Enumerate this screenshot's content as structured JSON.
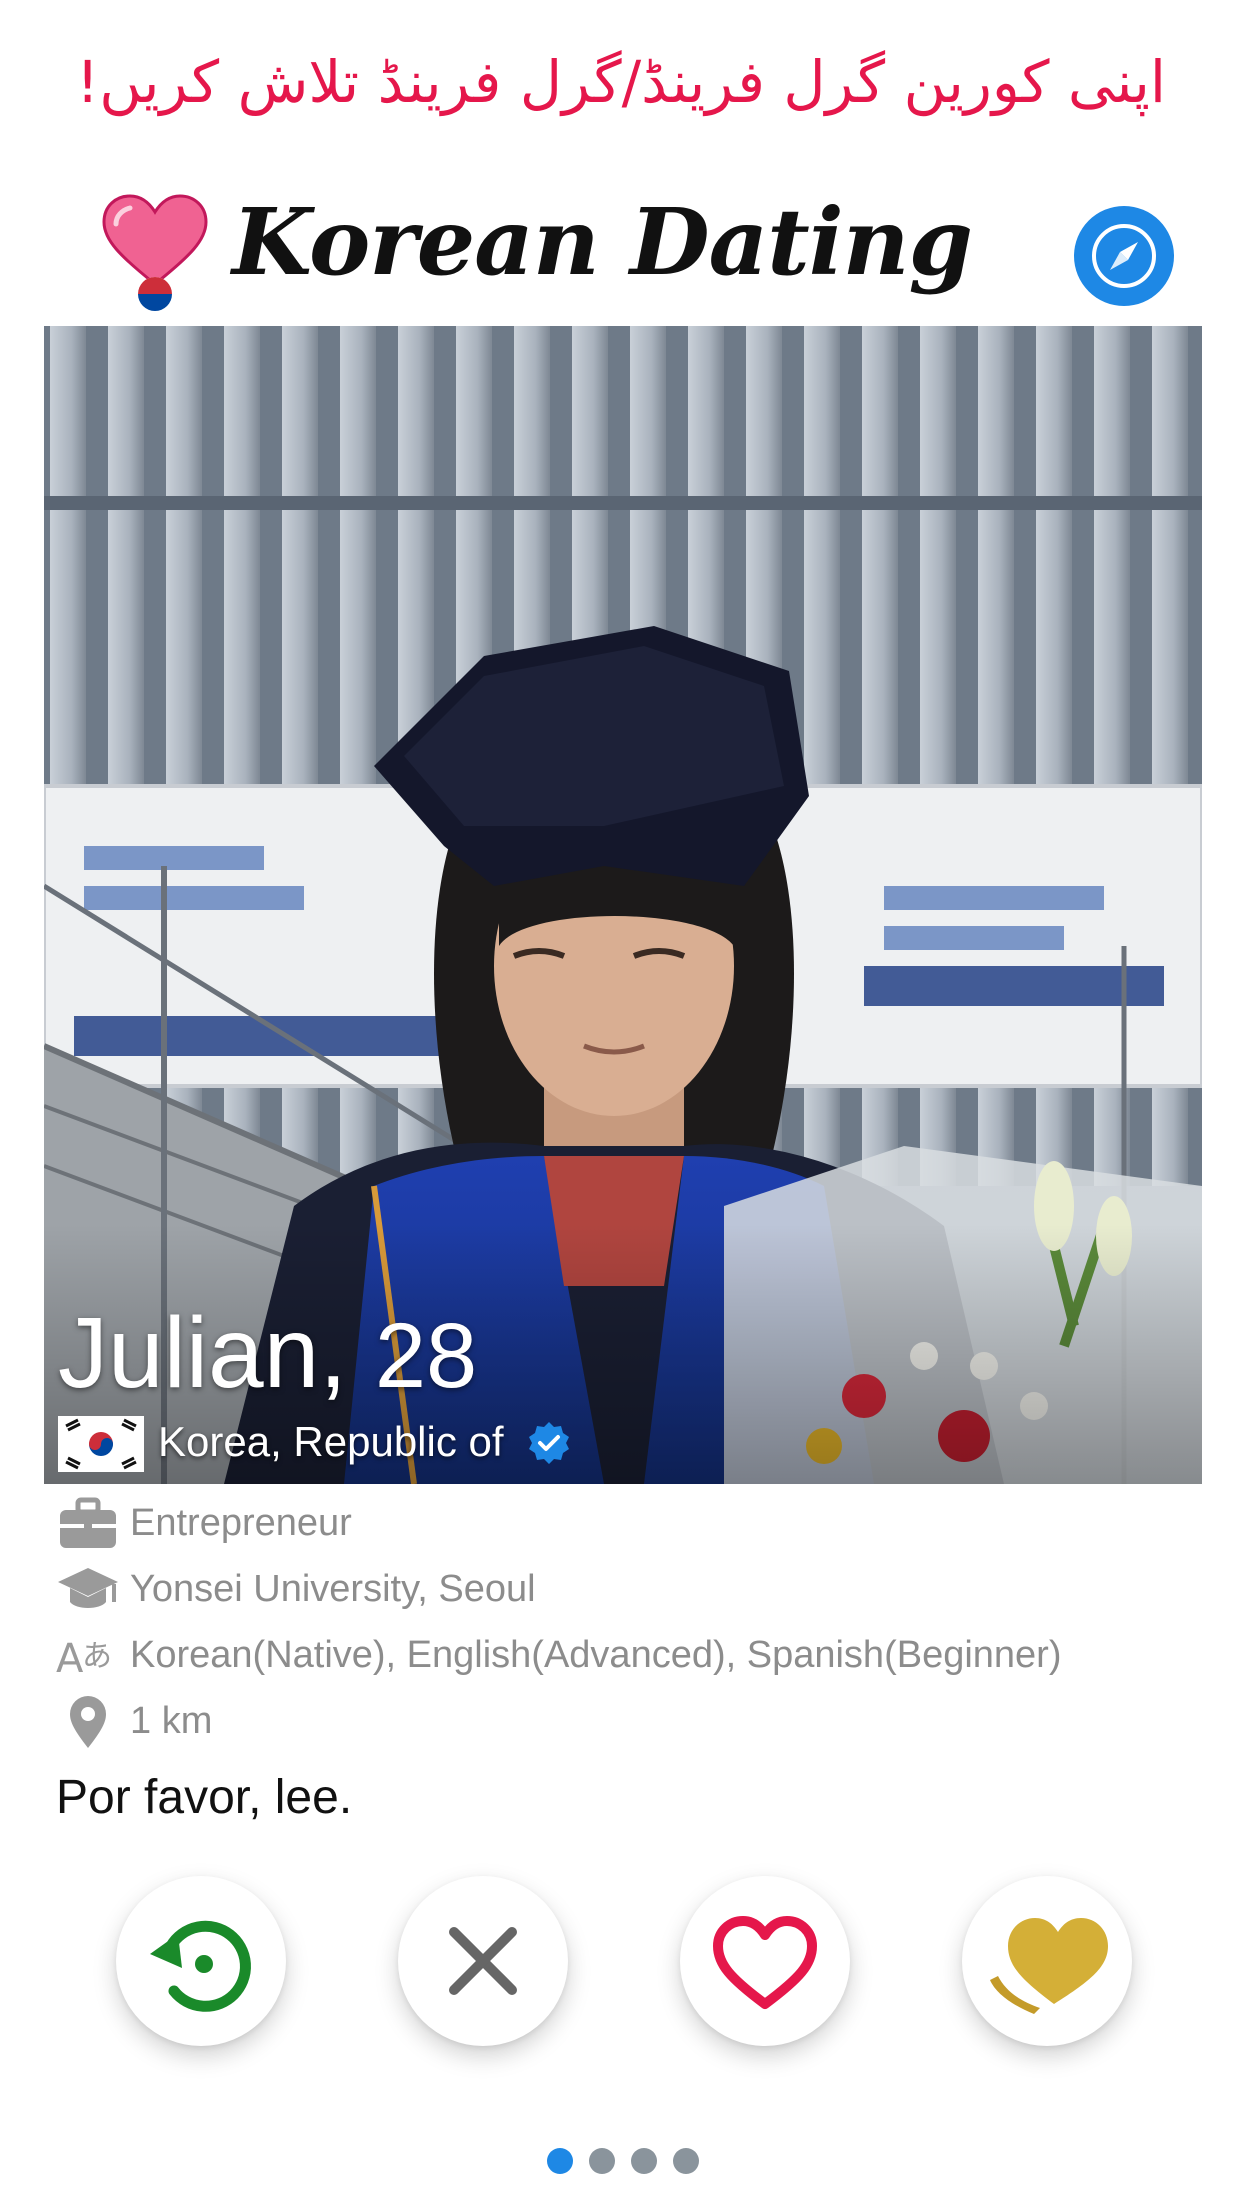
{
  "banner": {
    "text": "اپنی کورین گرل فرینڈ/گرل فرینڈ تلاش کریں!"
  },
  "header": {
    "app_name": "Korean Dating",
    "logo_icon": "heart-pin-icon",
    "discover_icon": "compass-icon"
  },
  "profile": {
    "name": "Julian,",
    "age": "28",
    "country": "Korea, Republic of",
    "verified": true,
    "details": [
      {
        "icon": "briefcase-icon",
        "text": "Entrepreneur"
      },
      {
        "icon": "graduation-cap-icon",
        "text": "Yonsei University, Seoul"
      },
      {
        "icon": "language-icon",
        "text": "Korean(Native), English(Advanced), Spanish(Beginner)"
      },
      {
        "icon": "location-pin-icon",
        "text": "1 km"
      }
    ],
    "bio": "Por favor, lee."
  },
  "actions": [
    {
      "name": "rewind-button",
      "icon": "rewind-icon",
      "color": "#1a8a2a"
    },
    {
      "name": "dislike-button",
      "icon": "close-icon",
      "color": "#666666"
    },
    {
      "name": "like-button",
      "icon": "heart-icon",
      "color": "#e5174b"
    },
    {
      "name": "super-like-button",
      "icon": "gold-heart-icon",
      "color": "#d4af37"
    }
  ],
  "pagination": {
    "count": 4,
    "active": 0
  },
  "colors": {
    "accent": "#e5174b",
    "blue": "#1e88e5",
    "muted_text": "#8c8c8c"
  }
}
